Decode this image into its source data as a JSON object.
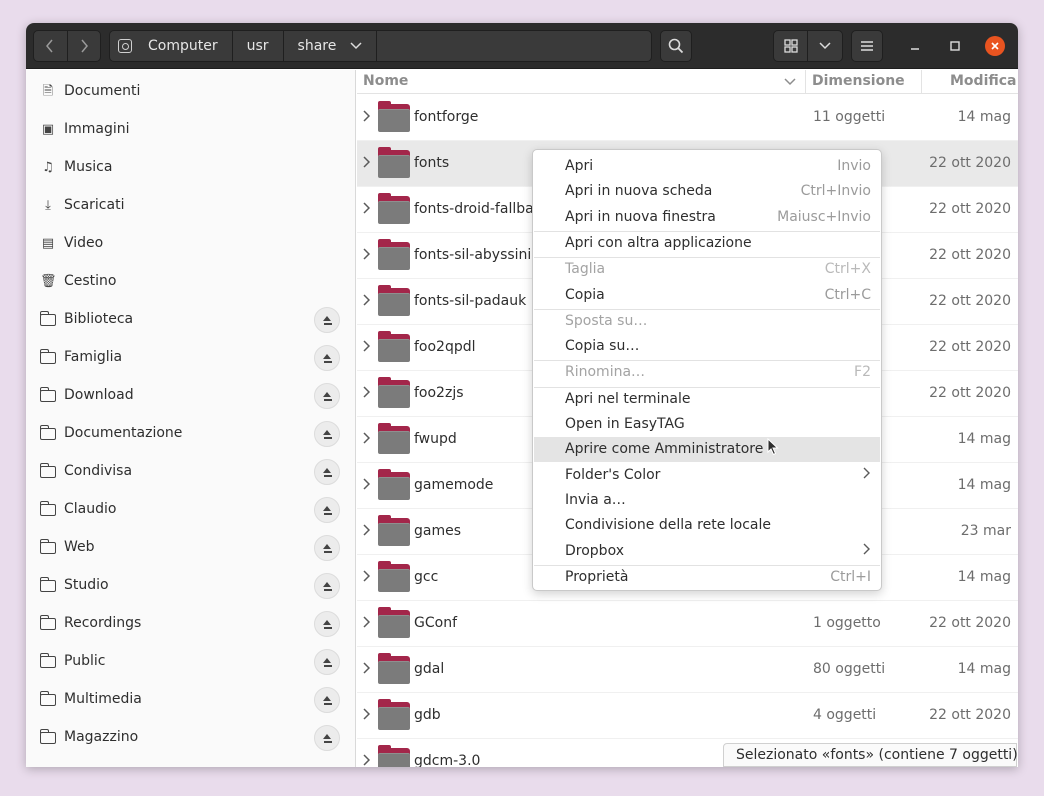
{
  "header": {
    "path": [
      "Computer",
      "usr",
      "share"
    ]
  },
  "sidebar": {
    "items": [
      {
        "label": "Documenti",
        "icon": "document-icon",
        "eject": false
      },
      {
        "label": "Immagini",
        "icon": "image-icon",
        "eject": false
      },
      {
        "label": "Musica",
        "icon": "music-icon",
        "eject": false
      },
      {
        "label": "Scaricati",
        "icon": "download-icon",
        "eject": false
      },
      {
        "label": "Video",
        "icon": "video-icon",
        "eject": false
      },
      {
        "label": "Cestino",
        "icon": "trash-icon",
        "eject": false
      },
      {
        "label": "Biblioteca",
        "icon": "folder-icon",
        "eject": true
      },
      {
        "label": "Famiglia",
        "icon": "folder-icon",
        "eject": true
      },
      {
        "label": "Download",
        "icon": "folder-icon",
        "eject": true
      },
      {
        "label": "Documentazione",
        "icon": "folder-icon",
        "eject": true
      },
      {
        "label": "Condivisa",
        "icon": "folder-icon",
        "eject": true
      },
      {
        "label": "Claudio",
        "icon": "folder-icon",
        "eject": true
      },
      {
        "label": "Web",
        "icon": "folder-icon",
        "eject": true
      },
      {
        "label": "Studio",
        "icon": "folder-icon",
        "eject": true
      },
      {
        "label": "Recordings",
        "icon": "folder-icon",
        "eject": true
      },
      {
        "label": "Public",
        "icon": "folder-icon",
        "eject": true
      },
      {
        "label": "Multimedia",
        "icon": "folder-icon",
        "eject": true
      },
      {
        "label": "Magazzino",
        "icon": "folder-icon",
        "eject": true
      }
    ]
  },
  "columns": {
    "name": "Nome",
    "size": "Dimensione",
    "modified": "Modifica"
  },
  "files": [
    {
      "name": "fontforge",
      "size": "11 oggetti",
      "modified": "14 mag",
      "selected": false
    },
    {
      "name": "fonts",
      "size": "",
      "modified": "22 ott 2020",
      "selected": true
    },
    {
      "name": "fonts-droid-fallba",
      "size": "",
      "modified": "22 ott 2020",
      "selected": false
    },
    {
      "name": "fonts-sil-abyssinic",
      "size": "",
      "modified": "22 ott 2020",
      "selected": false
    },
    {
      "name": "fonts-sil-padauk",
      "size": "",
      "modified": "22 ott 2020",
      "selected": false
    },
    {
      "name": "foo2qpdl",
      "size": "",
      "modified": "22 ott 2020",
      "selected": false
    },
    {
      "name": "foo2zjs",
      "size": "",
      "modified": "22 ott 2020",
      "selected": false
    },
    {
      "name": "fwupd",
      "size": "",
      "modified": "14 mag",
      "selected": false
    },
    {
      "name": "gamemode",
      "size": "",
      "modified": "14 mag",
      "selected": false
    },
    {
      "name": "games",
      "size": "",
      "modified": "23 mar",
      "selected": false
    },
    {
      "name": "gcc",
      "size": "",
      "modified": "14 mag",
      "selected": false
    },
    {
      "name": "GConf",
      "size": "1 oggetto",
      "modified": "22 ott 2020",
      "selected": false
    },
    {
      "name": "gdal",
      "size": "80 oggetti",
      "modified": "14 mag",
      "selected": false
    },
    {
      "name": "gdb",
      "size": "4 oggetti",
      "modified": "22 ott 2020",
      "selected": false
    },
    {
      "name": "gdcm-3.0",
      "size": "",
      "modified": "",
      "selected": false
    }
  ],
  "status": "Selezionato «fonts» (contiene 7 oggetti)",
  "context_menu": {
    "items": [
      {
        "label": "Apri",
        "accel": "Invio",
        "disabled": false
      },
      {
        "label": "Apri in nuova scheda",
        "accel": "Ctrl+Invio",
        "disabled": false
      },
      {
        "label": "Apri in nuova finestra",
        "accel": "Maiusc+Invio",
        "disabled": false
      },
      {
        "sep": true
      },
      {
        "label": "Apri con altra applicazione",
        "accel": "",
        "disabled": false
      },
      {
        "sep": true
      },
      {
        "label": "Taglia",
        "accel": "Ctrl+X",
        "disabled": true
      },
      {
        "label": "Copia",
        "accel": "Ctrl+C",
        "disabled": false
      },
      {
        "sep": true
      },
      {
        "label": "Sposta su…",
        "accel": "",
        "disabled": true
      },
      {
        "label": "Copia su…",
        "accel": "",
        "disabled": false
      },
      {
        "sep": true
      },
      {
        "label": "Rinomina…",
        "accel": "F2",
        "disabled": true
      },
      {
        "sep": true
      },
      {
        "label": "Apri nel terminale",
        "accel": "",
        "disabled": false
      },
      {
        "label": "Open in EasyTAG",
        "accel": "",
        "disabled": false
      },
      {
        "label": "Aprire come Amministratore",
        "accel": "",
        "disabled": false,
        "hover": true
      },
      {
        "label": "Folder's Color",
        "accel": "",
        "disabled": false,
        "submenu": true
      },
      {
        "label": "Invia a…",
        "accel": "",
        "disabled": false
      },
      {
        "label": "Condivisione della rete locale",
        "accel": "",
        "disabled": false
      },
      {
        "label": "Dropbox",
        "accel": "",
        "disabled": false,
        "submenu": true
      },
      {
        "sep": true
      },
      {
        "label": "Proprietà",
        "accel": "Ctrl+I",
        "disabled": false
      }
    ]
  },
  "colors": {
    "accent": "#e95420",
    "folder_tab": "#a3264a",
    "headerbar": "#2c2c2c"
  }
}
